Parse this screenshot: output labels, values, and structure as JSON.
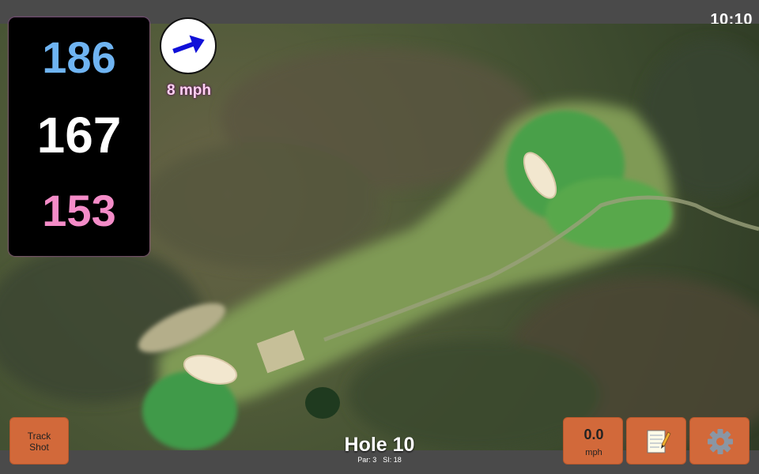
{
  "status_bar": {
    "time": "10:10"
  },
  "distances": {
    "back": "186",
    "middle": "167",
    "front": "153"
  },
  "wind": {
    "speed": "8 mph",
    "icon": "wind-arrow-icon",
    "direction_deg": -20
  },
  "buttons": {
    "track_shot": {
      "line1": "Track",
      "line2": "Shot"
    },
    "swing_speed": {
      "value": "0.0",
      "unit": "mph"
    },
    "notes_icon": "notes-icon",
    "settings_icon": "gear-icon"
  },
  "hole": {
    "title": "Hole 10",
    "par": "Par: 3",
    "si": "SI: 18"
  },
  "colors": {
    "back": "#6fb4f2",
    "middle": "#ffffff",
    "front": "#f48cc8",
    "button": "#d2693a",
    "wind_text": "#ffd1f0"
  }
}
